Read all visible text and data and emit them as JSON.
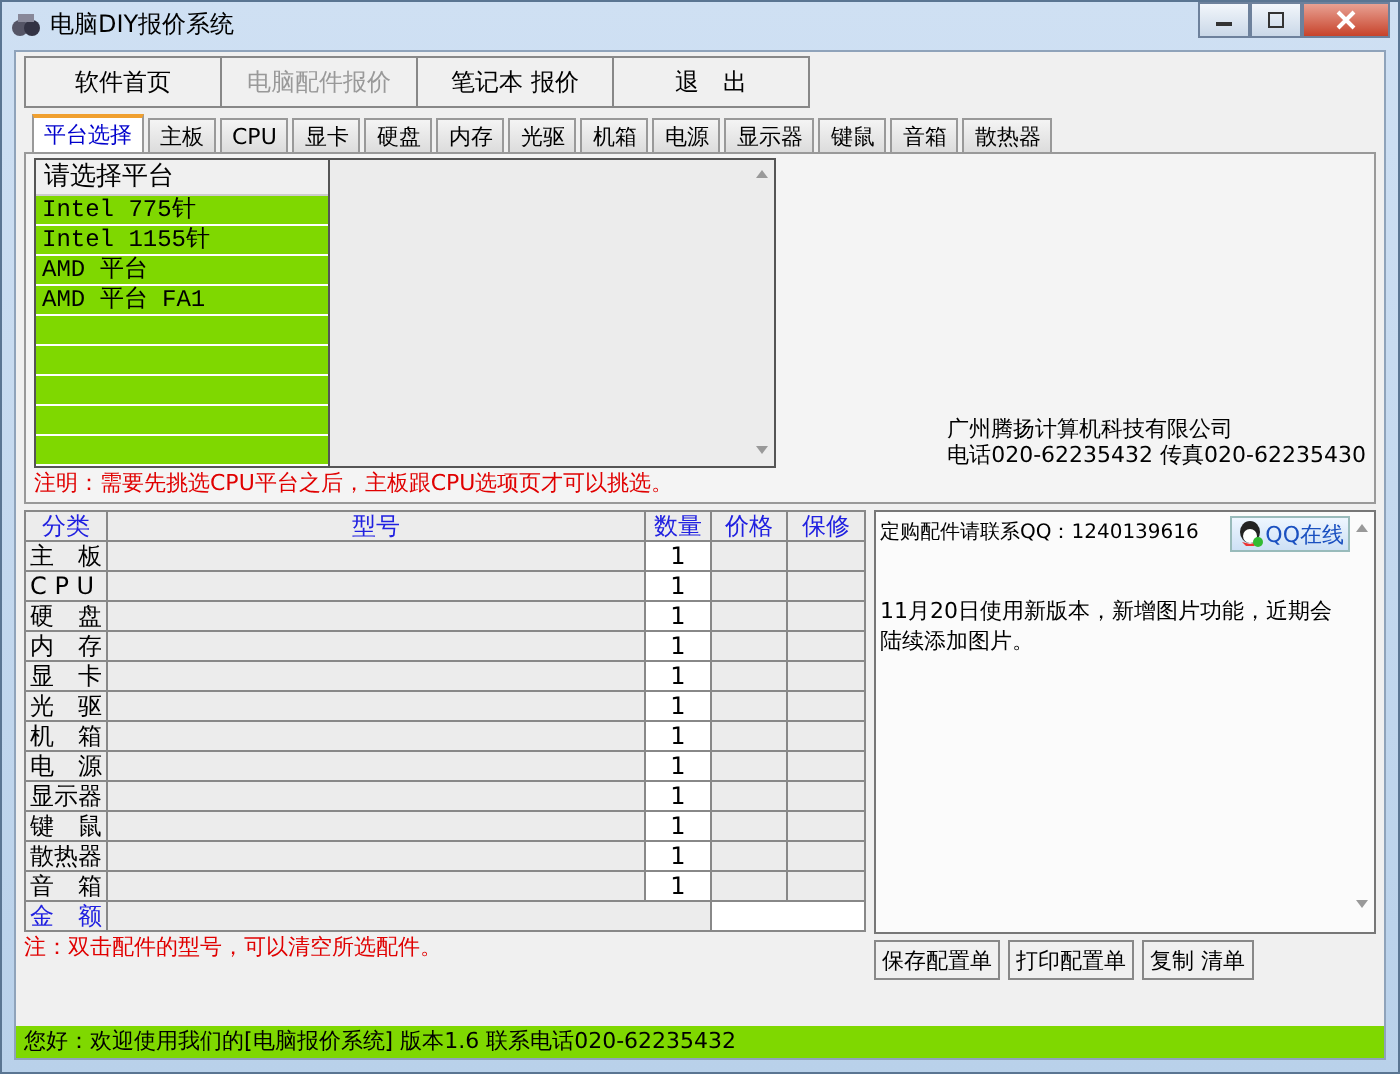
{
  "window": {
    "title": "电脑DIY报价系统"
  },
  "nav_buttons": [
    {
      "label": "软件首页",
      "disabled": false
    },
    {
      "label": "电脑配件报价",
      "disabled": true
    },
    {
      "label": "笔记本 报价",
      "disabled": false
    },
    {
      "label": "退　出",
      "disabled": false
    }
  ],
  "tabs": [
    {
      "label": "平台选择",
      "selected": true
    },
    {
      "label": "主板",
      "selected": false
    },
    {
      "label": "CPU",
      "selected": false
    },
    {
      "label": "显卡",
      "selected": false
    },
    {
      "label": "硬盘",
      "selected": false
    },
    {
      "label": "内存",
      "selected": false
    },
    {
      "label": "光驱",
      "selected": false
    },
    {
      "label": "机箱",
      "selected": false
    },
    {
      "label": "电源",
      "selected": false
    },
    {
      "label": "显示器",
      "selected": false
    },
    {
      "label": "键鼠",
      "selected": false
    },
    {
      "label": "音箱",
      "selected": false
    },
    {
      "label": "散热器",
      "selected": false
    }
  ],
  "platform_list": {
    "header": "请选择平台",
    "items": [
      "Intel 775针",
      "Intel 1155针",
      "AMD 平台",
      "AMD 平台 FA1"
    ]
  },
  "company": {
    "name": "广州腾扬计算机科技有限公司",
    "contact": "电话020-62235432 传真020-62235430"
  },
  "platform_note": "注明：需要先挑选CPU平台之后，主板跟CPU选项页才可以挑选。",
  "table": {
    "columns": [
      "分类",
      "型号",
      "数量",
      "价格",
      "保修"
    ],
    "rows": [
      {
        "category": "主　板",
        "quantity": "1"
      },
      {
        "category": "C P U",
        "quantity": "1"
      },
      {
        "category": "硬　盘",
        "quantity": "1"
      },
      {
        "category": "内　存",
        "quantity": "1"
      },
      {
        "category": "显　卡",
        "quantity": "1"
      },
      {
        "category": "光　驱",
        "quantity": "1"
      },
      {
        "category": "机　箱",
        "quantity": "1"
      },
      {
        "category": "电　源",
        "quantity": "1"
      },
      {
        "category": "显示器",
        "quantity": "1"
      },
      {
        "category": "键　鼠",
        "quantity": "1"
      },
      {
        "category": "散热器",
        "quantity": "1"
      },
      {
        "category": "音　箱",
        "quantity": "1"
      }
    ],
    "total_label": "金　额"
  },
  "table_note": "注：双击配件的型号，可以清空所选配件。",
  "info_panel": {
    "contact": "定购配件请联系QQ：1240139616",
    "qq_button": "QQ在线",
    "news": "11月20日使用新版本，新增图片功能，近期会陆续添加图片。"
  },
  "action_buttons": [
    "保存配置单",
    "打印配置单",
    "复制 清单"
  ],
  "status_bar": "您好：欢迎使用我们的[电脑报价系统] 版本1.6 联系电话020-62235432"
}
